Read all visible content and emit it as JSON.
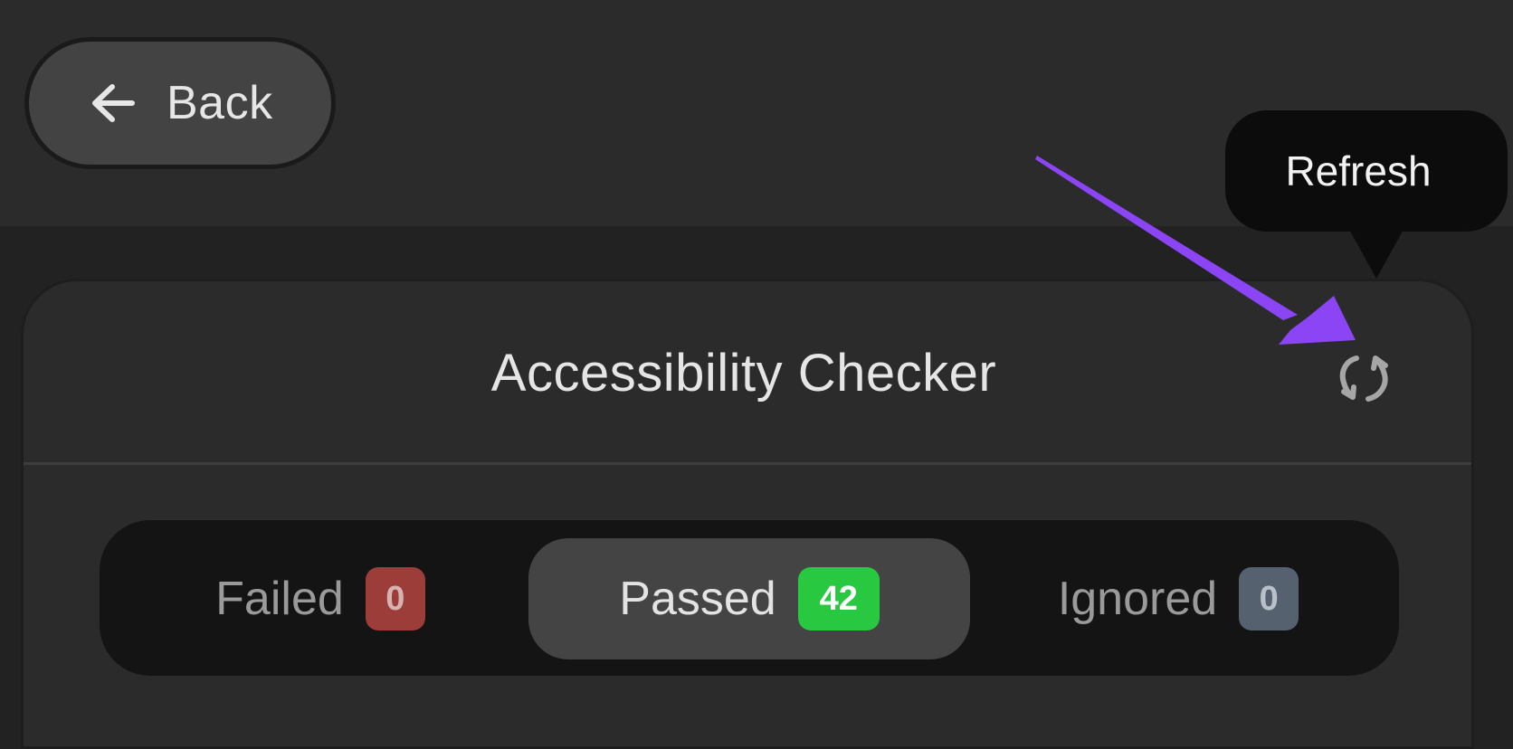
{
  "back_button": {
    "label": "Back",
    "icon": "arrow-left-icon"
  },
  "tooltip": {
    "text": "Refresh"
  },
  "panel": {
    "title": "Accessibility Checker",
    "refresh_icon": "refresh-icon"
  },
  "filters": {
    "tabs": [
      {
        "label": "Failed",
        "count": "0",
        "color": "#9c3d3a"
      },
      {
        "label": "Passed",
        "count": "42",
        "color": "#28c940",
        "selected": true
      },
      {
        "label": "Ignored",
        "count": "0",
        "color": "#566170"
      }
    ]
  },
  "annotation": {
    "arrow_color": "#8b45f5"
  },
  "colors": {
    "background": "#222222",
    "surface": "#2b2b2b",
    "segmented_track": "#141414",
    "selected_tab": "#444444",
    "tooltip": "#0c0c0c"
  }
}
